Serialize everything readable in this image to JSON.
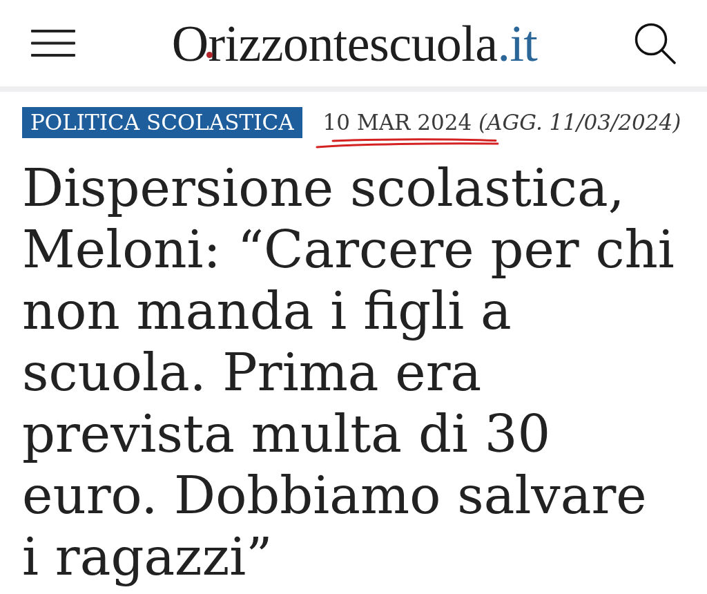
{
  "header": {
    "logo": {
      "name": "Orizzontescuola",
      "domain": ".it"
    }
  },
  "article": {
    "category": "POLITICA SCOLASTICA",
    "date": {
      "text": "10 MAR 2024 *(AGG. 11/03/2024)*",
      "underlined": true
    },
    "headline": "Dispersione scolastica, Meloni: “Carcere per chi non manda i figli a scuola. Prima era prevista multa di 30 euro. Dobbiamo salvare i ragazzi”"
  }
}
